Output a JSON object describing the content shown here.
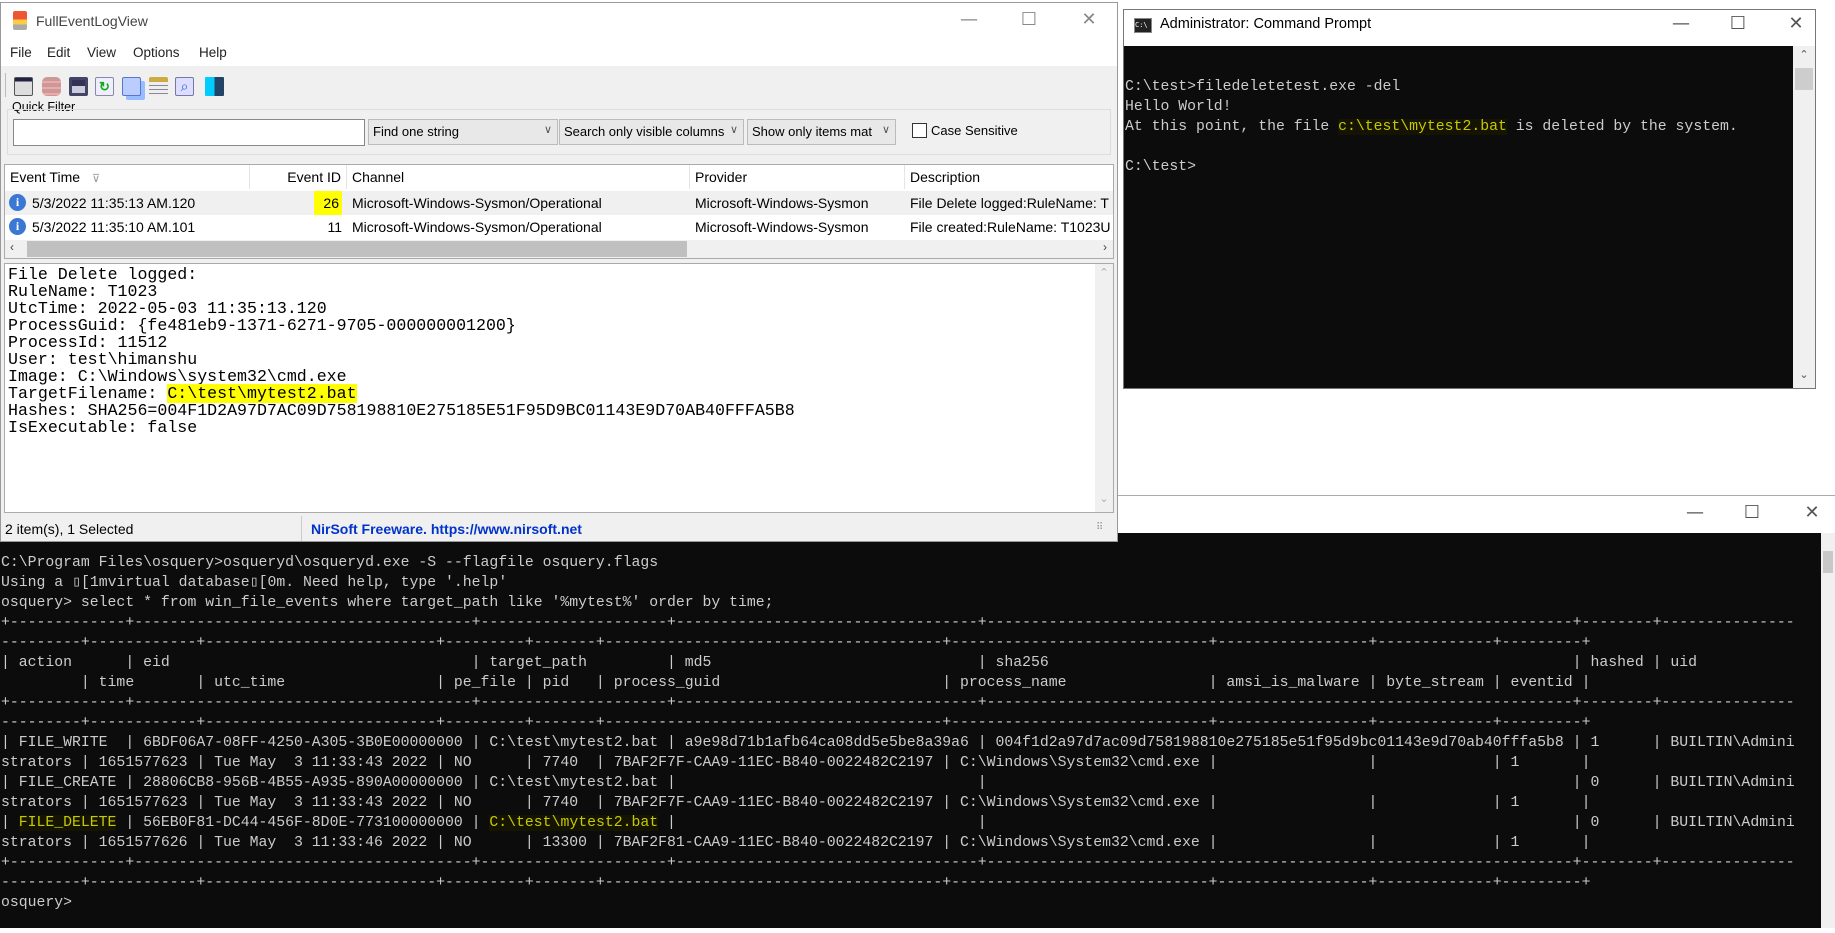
{
  "colors": {
    "terminal_bg": "#0c0c0c",
    "terminal_fg": "#cccccc",
    "terminal_highlight": "#c8c800",
    "highlight_yellow": "#ffff00",
    "nirsoft_link": "#0033cc"
  },
  "fev": {
    "title": "FullEventLogView",
    "window_controls": {
      "minimize": "—",
      "maximize": "☐",
      "close": "✕"
    },
    "menu": [
      "File",
      "Edit",
      "View",
      "Options",
      "Help"
    ],
    "toolbar_icons": [
      "properties-icon",
      "data-source-icon",
      "save-icon",
      "refresh-icon",
      "copy-icon",
      "html-report-icon",
      "find-icon",
      "exit-icon"
    ],
    "quick_filter_label": "Quick Filter",
    "filter_input": {
      "value": "",
      "placeholder": ""
    },
    "filter_mode": "Find one string",
    "search_scope": "Search only visible columns",
    "show_mode": "Show only items mat",
    "case_sensitive_label": "Case Sensitive",
    "case_sensitive": false,
    "columns": [
      "Event Time",
      "Event ID",
      "Channel",
      "Provider",
      "Description"
    ],
    "rows": [
      {
        "time": "5/3/2022 11:35:13 AM.120",
        "event_id": "26",
        "channel": "Microsoft-Windows-Sysmon/Operational",
        "provider": "Microsoft-Windows-Sysmon",
        "description": "File Delete logged:RuleName: T",
        "selected": true
      },
      {
        "time": "5/3/2022 11:35:10 AM.101",
        "event_id": "11",
        "channel": "Microsoft-Windows-Sysmon/Operational",
        "provider": "Microsoft-Windows-Sysmon",
        "description": "File created:RuleName: T1023U",
        "selected": false
      }
    ],
    "detail_lines": [
      "File Delete logged:",
      "RuleName: T1023",
      "UtcTime: 2022-05-03 11:35:13.120",
      "ProcessGuid: {fe481eb9-1371-6271-9705-000000001200}",
      "ProcessId: 11512",
      "User: test\\himanshu",
      "Image: C:\\Windows\\system32\\cmd.exe",
      {
        "label": "TargetFilename: ",
        "value": "C:\\test\\mytest2.bat"
      },
      "Hashes: SHA256=004F1D2A97D7AC09D758198810E275185E51F95D9BC01143E9D70AB40FFFA5B8",
      "IsExecutable: false"
    ],
    "status_count": "2 item(s), 1 Selected",
    "status_link": "NirSoft Freeware. https://www.nirsoft.net"
  },
  "cmd": {
    "title": "Administrator: Command Prompt",
    "lines": [
      [
        {
          "t": ""
        }
      ],
      [
        {
          "t": "C:\\test>filedeletetest.exe -del"
        }
      ],
      [
        {
          "t": "Hello World!"
        }
      ],
      [
        {
          "t": "At this point, the file "
        },
        {
          "t": "c:\\test\\mytest2.bat",
          "hl": true
        },
        {
          "t": " is deleted by the system."
        }
      ],
      [
        {
          "t": ""
        }
      ],
      [
        {
          "t": "C:\\test>"
        }
      ]
    ]
  },
  "osquery": {
    "command_line": "C:\\Program Files\\osquery>osqueryd\\osqueryd.exe -S --flagfile osquery.flags",
    "using_line": "Using a ▯[1mvirtual database▯[0m. Need help, type '.help'",
    "query_line": "osquery> select * from win_file_events where target_path like '%mytest%' order by time;",
    "table": {
      "columns": [
        "action",
        "eid",
        "target_path",
        "md5",
        "sha256",
        "hashed",
        "uid",
        "time",
        "utc_time",
        "pe_file",
        "pid",
        "process_guid",
        "process_name",
        "amsi_is_malware",
        "byte_stream",
        "eventid"
      ],
      "rows": [
        [
          "FILE_WRITE",
          "6BDF06A7-08FF-4250-A305-3B0E00000000",
          "C:\\test\\mytest2.bat",
          "a9e98d71b1afb64ca08dd5e5be8a39a6",
          "004f1d2a97d7ac09d758198810e275185e51f95d9bc01143e9d70ab40fffa5b8",
          "1",
          "BUILTIN\\Administrators",
          "1651577623",
          "Tue May  3 11:33:43 2022",
          "NO",
          "7740",
          "7BAF2F7F-CAA9-11EC-B840-0022482C2197",
          "C:\\Windows\\System32\\cmd.exe",
          "",
          "",
          "1"
        ],
        [
          "FILE_CREATE",
          "28806CB8-956B-4B55-A935-890A00000000",
          "C:\\test\\mytest2.bat",
          "",
          "",
          "0",
          "BUILTIN\\Administrators",
          "1651577623",
          "Tue May  3 11:33:43 2022",
          "NO",
          "7740",
          "7BAF2F7F-CAA9-11EC-B840-0022482C2197",
          "C:\\Windows\\System32\\cmd.exe",
          "",
          "",
          "1"
        ],
        [
          "FILE_DELETE",
          "56EB0F81-DC44-456F-8D0E-773100000000",
          "C:\\test\\mytest2.bat",
          "",
          "",
          "0",
          "BUILTIN\\Administrators",
          "1651577626",
          "Tue May  3 11:33:46 2022",
          "NO",
          "13300",
          "7BAF2F81-CAA9-11EC-B840-0022482C2197",
          "C:\\Windows\\System32\\cmd.exe",
          "",
          "",
          "1"
        ]
      ],
      "highlight_row": 2,
      "highlight_columns": [
        "action",
        "target_path"
      ]
    },
    "prompt": "osquery>"
  }
}
